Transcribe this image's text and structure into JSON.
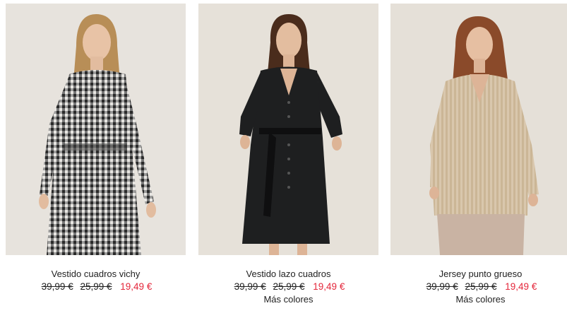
{
  "products": [
    {
      "name": "Vestido cuadros vichy",
      "price_original": "39,99 €",
      "price_previous": "25,99 €",
      "price_sale": "19,49 €",
      "more_colors": ""
    },
    {
      "name": "Vestido lazo cuadros",
      "price_original": "39,99 €",
      "price_previous": "25,99 €",
      "price_sale": "19,49 €",
      "more_colors": "Más colores"
    },
    {
      "name": "Jersey punto grueso",
      "price_original": "39,99 €",
      "price_previous": "25,99 €",
      "price_sale": "19,49 €",
      "more_colors": "Más colores"
    }
  ],
  "colors": {
    "sale_price": "#e4263a",
    "text": "#222222",
    "photo_background": "#e9e4dc"
  }
}
